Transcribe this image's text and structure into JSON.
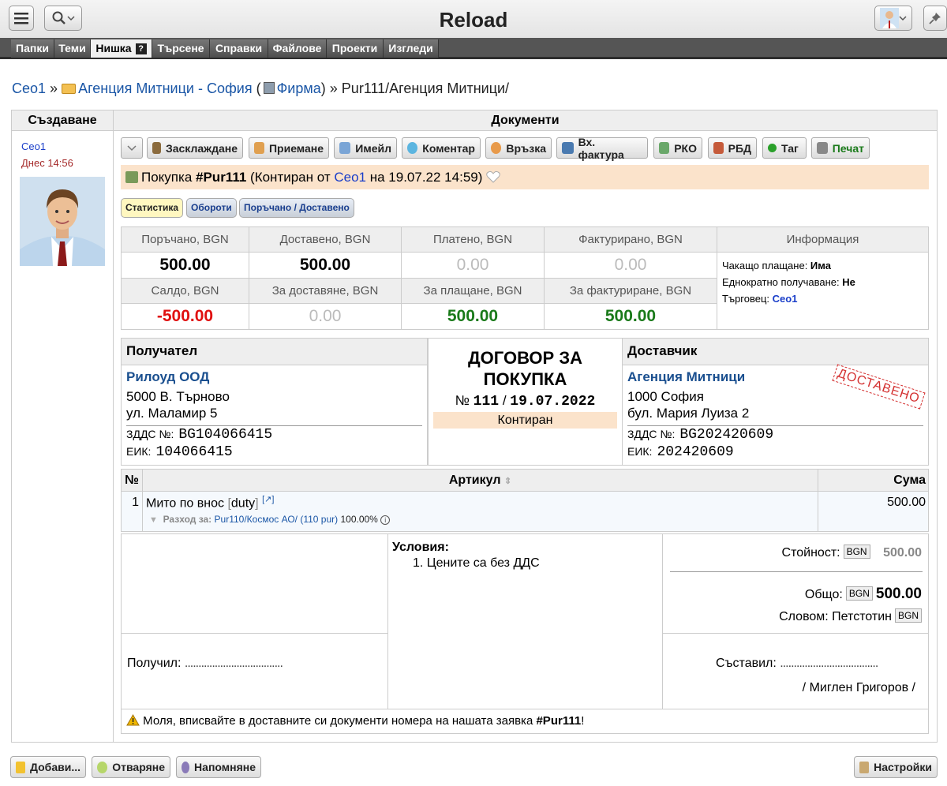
{
  "app": {
    "title": "Reload"
  },
  "menu": [
    "Папки",
    "Теми",
    "Нишка",
    "Търсене",
    "Справки",
    "Файлове",
    "Проекти",
    "Изгледи"
  ],
  "menu_help": "?",
  "breadcrumb": {
    "user": "Ceo1",
    "sep": "»",
    "folder": "Агенция Митници - София",
    "firm_open": "(",
    "firm": "Фирма",
    "firm_close": ")",
    "sep2": "»",
    "path": "Pur111/Агенция Митници/"
  },
  "left": {
    "header": "Създаване",
    "user": "Ceo1",
    "time": "Днес 14:56"
  },
  "main": {
    "header": "Документи"
  },
  "toolbar": [
    "Засклаждане",
    "Приемане",
    "Имейл",
    "Коментар",
    "Връзка",
    "Вх. фактура",
    "РКО",
    "РБД",
    "Таг",
    "Печат"
  ],
  "doc": {
    "prefix": "Покупка",
    "number": "#Pur111",
    "status_open": "(Контиран от",
    "user": "Ceo1",
    "status_close": "на 19.07.22 14:59)"
  },
  "tabs": [
    "Статистика",
    "Обороти",
    "Поръчано / Доставено"
  ],
  "stats": {
    "h1": [
      "Поръчано, BGN",
      "Доставено, BGN",
      "Платено, BGN",
      "Фактурирано, BGN"
    ],
    "v1": [
      "500.00",
      "500.00",
      "0.00",
      "0.00"
    ],
    "h2": [
      "Салдо, BGN",
      "За доставяне, BGN",
      "За плащане, BGN",
      "За фактуриране, BGN"
    ],
    "v2": [
      "-500.00",
      "0.00",
      "500.00",
      "500.00"
    ],
    "info_header": "Информация",
    "info": [
      {
        "label": "Чакащо плащане",
        "value": "Има"
      },
      {
        "label": "Еднократно получаване",
        "value": "Не"
      },
      {
        "label": "Търговец",
        "value": "Ceo1"
      }
    ]
  },
  "recipient": {
    "header": "Получател",
    "name": "Рилоуд ООД",
    "addr1": "5000 В. Търново",
    "addr2": "ул. Маламир 5",
    "vat_label": "ЗДДС №:",
    "vat": "BG104066415",
    "eik_label": "ЕИК:",
    "eik": "104066415"
  },
  "contract": {
    "title": "ДОГОВОР ЗА ПОКУПКА",
    "no_label": "№",
    "number": "111",
    "sep": "/",
    "date": "19.07.2022",
    "state": "Контиран"
  },
  "supplier": {
    "header": "Доставчик",
    "name": "Агенция Митници",
    "addr1": "1000 София",
    "addr2": "бул. Мария Луиза 2",
    "vat_label": "ЗДДС №:",
    "vat": "BG202420609",
    "eik_label": "ЕИК:",
    "eik": "202420609",
    "stamp": "ДОСТАВЕНО"
  },
  "items": {
    "col_no": "№",
    "col_item": "Артикул",
    "col_sum": "Сума",
    "rows": [
      {
        "no": "1",
        "name": "Мито по внос",
        "code": "duty",
        "link": "[↗]",
        "expense_label": "Разход за:",
        "expense_link": "Pur110/Космос АО/ (110 pur)",
        "pct": "100.00%",
        "sum": "500.00"
      }
    ]
  },
  "terms": {
    "title": "Условия:",
    "list": [
      "Цените са без ДДС"
    ]
  },
  "totals": {
    "value_label": "Стойност:",
    "currency": "BGN",
    "value": "500.00",
    "total_label": "Общо:",
    "total": "500.00",
    "words_label": "Словом: Петстотин"
  },
  "signatures": {
    "received": "Получил:",
    "dots": "....................................",
    "composed": "Съставил:",
    "composer": "/ Миглен Григоров /"
  },
  "notice": {
    "text": "Моля, вписвайте в доставните си документи номера на нашата заявка",
    "ref": "#Pur111",
    "end": "!"
  },
  "bottom": [
    "Добави...",
    "Отваряне",
    "Напомняне",
    "Настройки"
  ],
  "colors": {
    "accent": "#1a56a6",
    "red": "#e01010",
    "green": "#1a7a1a",
    "doc_bar": "#fbe3cb"
  }
}
